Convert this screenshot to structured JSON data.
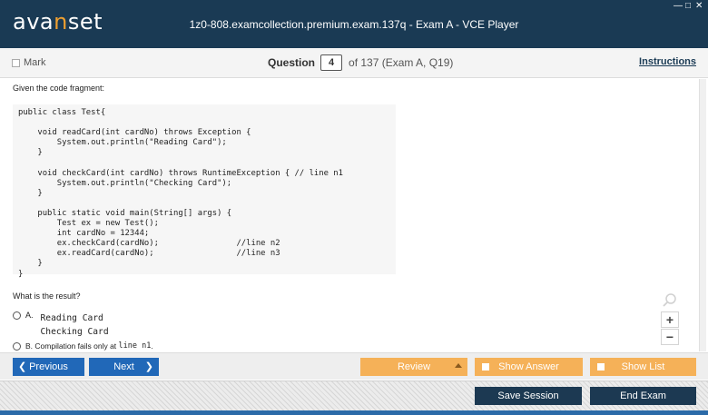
{
  "app": {
    "logo_pre": "ava",
    "logo_accent": "n",
    "logo_post": "set",
    "window_title": "1z0-808.examcollection.premium.exam.137q - Exam A - VCE Player",
    "win_min": "—",
    "win_max": "□",
    "win_close": "✕"
  },
  "question_bar": {
    "mark_label": "Mark",
    "question_label": "Question",
    "question_number": "4",
    "question_of": "of 137 (Exam A, Q19)",
    "instructions_label": "Instructions"
  },
  "content": {
    "intro": "Given the code fragment:",
    "code": "public class Test{\n\n    void readCard(int cardNo) throws Exception {\n        System.out.println(\"Reading Card\");\n    }\n\n    void checkCard(int cardNo) throws RuntimeException { // line n1\n        System.out.println(\"Checking Card\");\n    }\n\n    public static void main(String[] args) {\n        Test ex = new Test();\n        int cardNo = 12344;\n        ex.checkCard(cardNo);                //line n2\n        ex.readCard(cardNo);                 //line n3\n    }\n}",
    "question": "What is the result?",
    "options": [
      {
        "letter": "A.",
        "text": "Reading Card\nChecking Card"
      },
      {
        "letter": "B.",
        "text_pre": "Compilation fails only at ",
        "text_code": "line n1",
        "text_post": "."
      }
    ]
  },
  "zoom": {
    "in": "+",
    "out": "−"
  },
  "nav": {
    "previous": "Previous",
    "next": "Next",
    "review": "Review",
    "show_answer": "Show Answer",
    "show_list": "Show List",
    "save_session": "Save Session",
    "end_exam": "End Exam"
  },
  "colors": {
    "titlebar": "#1a3a54",
    "accent_orange": "#f5b158",
    "nav_blue": "#2168b8",
    "dark_button": "#1c3952"
  }
}
